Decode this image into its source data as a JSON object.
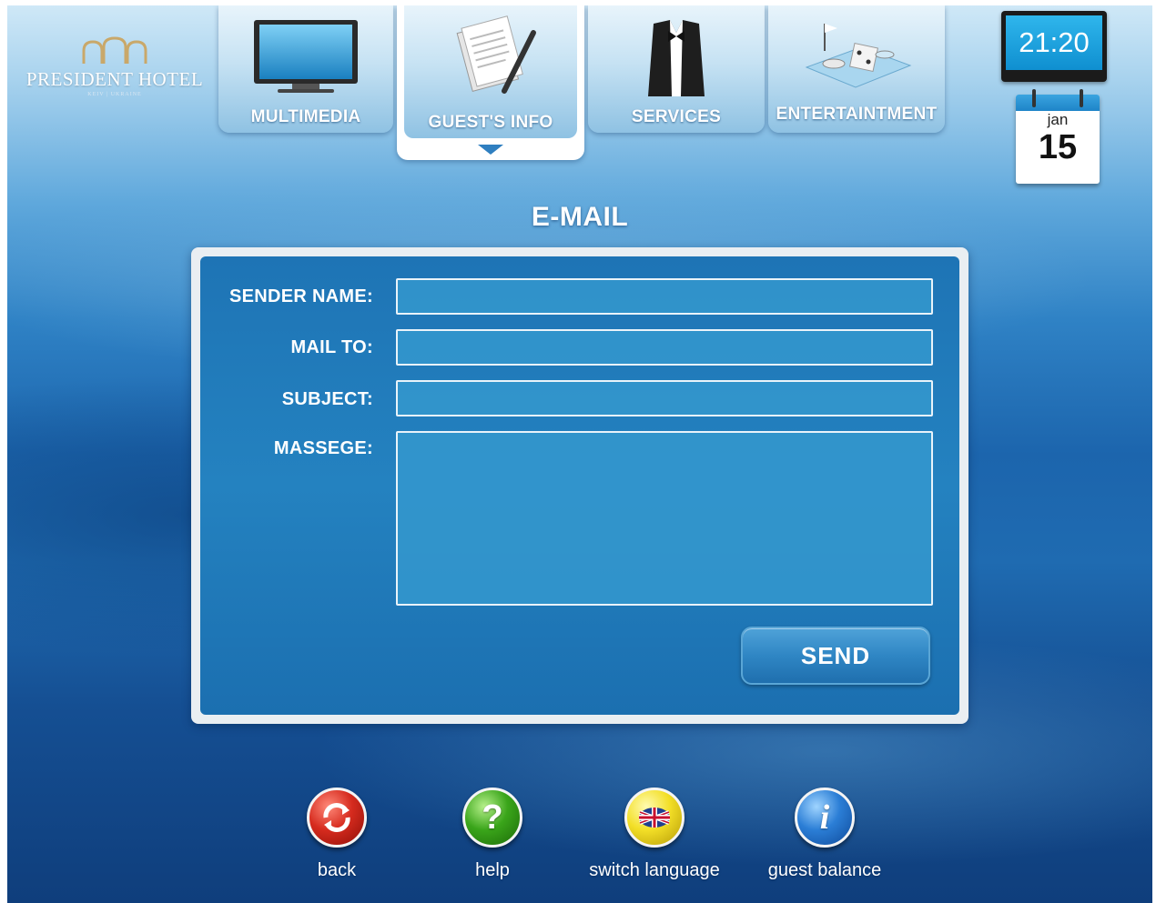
{
  "brand": {
    "name": "PRESIDENT HOTEL",
    "location": "KEIV | UKRAINE"
  },
  "nav": {
    "tabs": [
      {
        "label": "MULTIMEDIA",
        "icon": "tv-icon",
        "active": false
      },
      {
        "label": "GUEST'S INFO",
        "icon": "documents-pen-icon",
        "active": true
      },
      {
        "label": "SERVICES",
        "icon": "tuxedo-icon",
        "active": false
      },
      {
        "label": "ENTERTAINTMENT",
        "icon": "casino-icon",
        "active": false
      }
    ]
  },
  "clock": {
    "time": "21:20"
  },
  "calendar": {
    "month": "jan",
    "day": "15"
  },
  "page": {
    "title": "E-MAIL"
  },
  "form": {
    "sender_label": "SENDER NAME:",
    "sender_value": "",
    "mailto_label": "MAIL TO:",
    "mailto_value": "",
    "subject_label": "SUBJECT:",
    "subject_value": "",
    "message_label": "MASSEGE:",
    "message_value": "",
    "send_label": "SEND"
  },
  "toolbar": {
    "back": {
      "label": "back",
      "icon": "refresh-arrows-icon",
      "color": "#d62b1e"
    },
    "help": {
      "label": "help",
      "icon": "question-mark-icon",
      "color": "#3aa51a"
    },
    "language": {
      "label": "switch language",
      "icon": "uk-flag-icon",
      "color": "#f3df27"
    },
    "balance": {
      "label": "guest balance",
      "icon": "info-icon",
      "color": "#2b7ed6"
    }
  }
}
